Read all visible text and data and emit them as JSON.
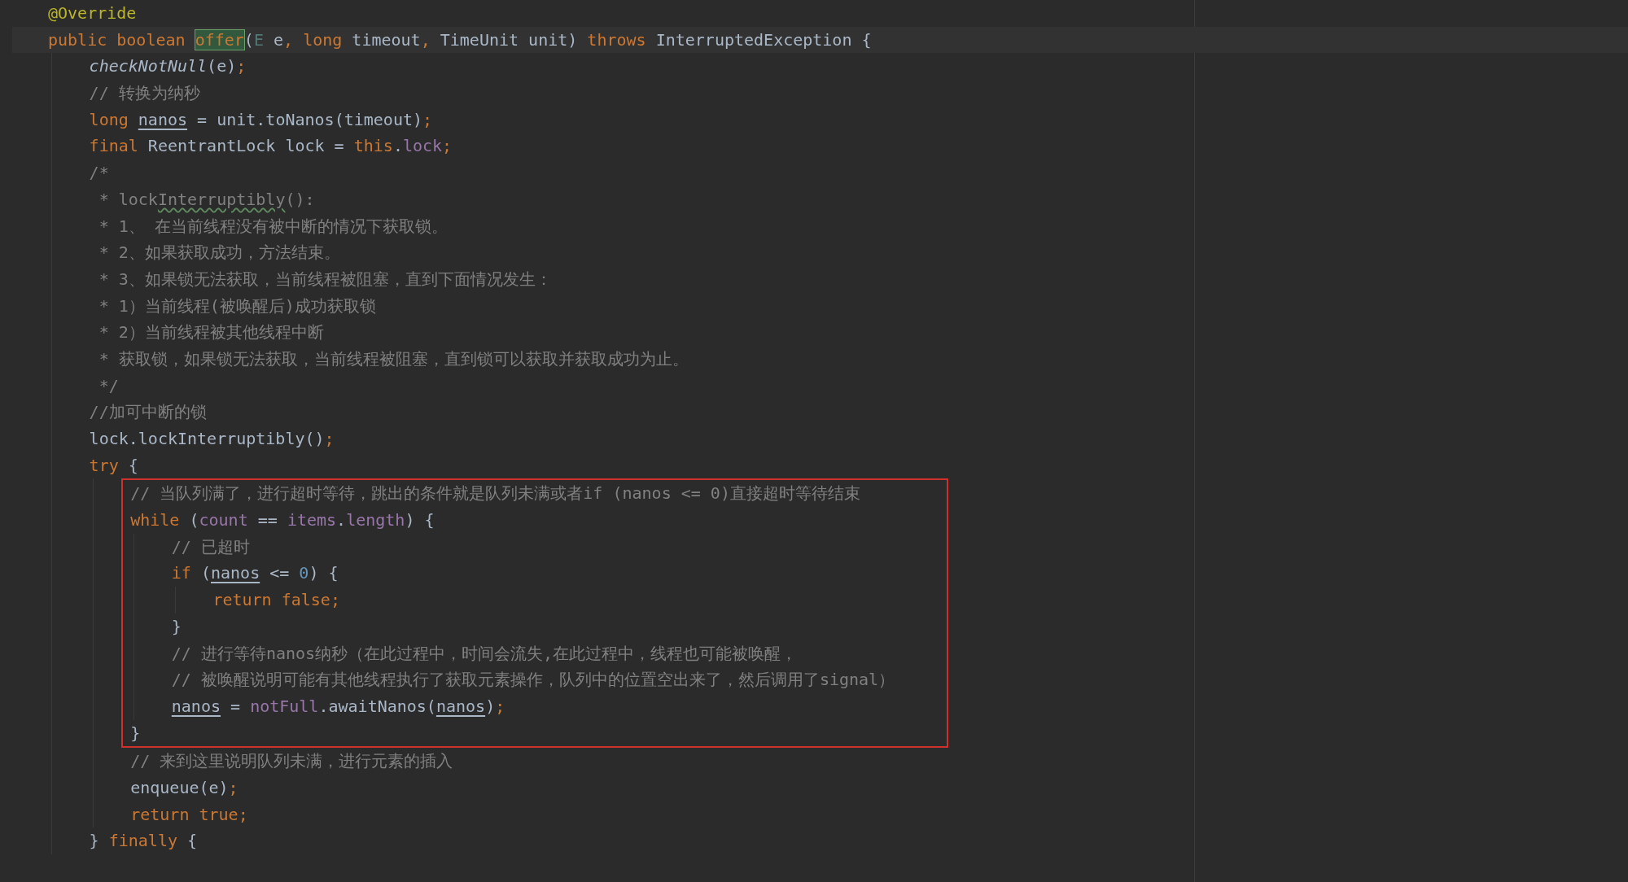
{
  "lines": [
    {
      "kind": "line",
      "tokens": [
        {
          "text": "@Override",
          "kind": "annot"
        }
      ]
    },
    {
      "kind": "line",
      "current": true,
      "tokens": [
        {
          "text": "public boolean ",
          "kind": "kw"
        },
        {
          "text": "offer",
          "kind": "match"
        },
        {
          "text": "(",
          "kind": "plain"
        },
        {
          "text": "E",
          "kind": "tparam"
        },
        {
          "text": " e",
          "kind": "plain"
        },
        {
          "text": ", ",
          "kind": "kw"
        },
        {
          "text": "long",
          "kind": "kw"
        },
        {
          "text": " timeout",
          "kind": "plain"
        },
        {
          "text": ", ",
          "kind": "kw"
        },
        {
          "text": "TimeUnit unit) ",
          "kind": "plain"
        },
        {
          "text": "throws",
          "kind": "kw"
        },
        {
          "text": " InterruptedException {",
          "kind": "plain"
        }
      ],
      "children": [
        {
          "kind": "line",
          "tokens": [
            {
              "text": "checkNotNull",
              "kind": "italic"
            },
            {
              "text": "(e)",
              "kind": "plain"
            },
            {
              "text": ";",
              "kind": "kw"
            }
          ]
        },
        {
          "kind": "line",
          "tokens": [
            {
              "text": "// 转换为纳秒",
              "kind": "comment"
            }
          ]
        },
        {
          "kind": "line",
          "tokens": [
            {
              "text": "long ",
              "kind": "kw"
            },
            {
              "text": "nanos",
              "kind": "var"
            },
            {
              "text": " = unit.toNanos(timeout)",
              "kind": "plain"
            },
            {
              "text": ";",
              "kind": "kw"
            }
          ]
        },
        {
          "kind": "line",
          "tokens": [
            {
              "text": "final ",
              "kind": "kw"
            },
            {
              "text": "ReentrantLock lock = ",
              "kind": "plain"
            },
            {
              "text": "this",
              "kind": "kw"
            },
            {
              "text": ".",
              "kind": "plain"
            },
            {
              "text": "lock",
              "kind": "field"
            },
            {
              "text": ";",
              "kind": "kw"
            }
          ]
        },
        {
          "kind": "line",
          "tokens": [
            {
              "text": "/*",
              "kind": "comment"
            }
          ]
        },
        {
          "kind": "line",
          "tokens": [
            {
              "text": " * lock",
              "kind": "comment"
            },
            {
              "text": "Interruptibly",
              "kind": "typo"
            },
            {
              "text": "():",
              "kind": "comment"
            }
          ]
        },
        {
          "kind": "line",
          "tokens": [
            {
              "text": " * 1、 在当前线程没有被中断的情况下获取锁。",
              "kind": "comment"
            }
          ]
        },
        {
          "kind": "line",
          "tokens": [
            {
              "text": " * 2、如果获取成功，方法结束。",
              "kind": "comment"
            }
          ]
        },
        {
          "kind": "line",
          "tokens": [
            {
              "text": " * 3、如果锁无法获取，当前线程被阻塞，直到下面情况发生：",
              "kind": "comment"
            }
          ]
        },
        {
          "kind": "line",
          "tokens": [
            {
              "text": " * 1）当前线程(被唤醒后)成功获取锁",
              "kind": "comment"
            }
          ]
        },
        {
          "kind": "line",
          "tokens": [
            {
              "text": " * 2）当前线程被其他线程中断",
              "kind": "comment"
            }
          ]
        },
        {
          "kind": "line",
          "tokens": [
            {
              "text": " * 获取锁，如果锁无法获取，当前线程被阻塞，直到锁可以获取并获取成功为止。",
              "kind": "comment"
            }
          ]
        },
        {
          "kind": "line",
          "tokens": [
            {
              "text": " */",
              "kind": "comment"
            }
          ]
        },
        {
          "kind": "line",
          "tokens": [
            {
              "text": "//加可中断的锁",
              "kind": "comment"
            }
          ]
        },
        {
          "kind": "line",
          "tokens": [
            {
              "text": "lock.lockInterruptibly()",
              "kind": "plain"
            },
            {
              "text": ";",
              "kind": "kw"
            }
          ]
        },
        {
          "kind": "line",
          "tokens": [
            {
              "text": "try",
              "kind": "kw"
            },
            {
              "text": " {",
              "kind": "plain"
            }
          ],
          "children": [
            {
              "kind": "box",
              "children": [
                {
                  "kind": "line",
                  "tokens": [
                    {
                      "text": "// 当队列满了，进行超时等待，跳出的条件就是队列未满或者if (nanos <= 0)直接超时等待结束",
                      "kind": "comment"
                    }
                  ]
                },
                {
                  "kind": "line",
                  "tokens": [
                    {
                      "text": "while",
                      "kind": "kw"
                    },
                    {
                      "text": " (",
                      "kind": "plain"
                    },
                    {
                      "text": "count",
                      "kind": "field"
                    },
                    {
                      "text": " == ",
                      "kind": "plain"
                    },
                    {
                      "text": "items",
                      "kind": "field"
                    },
                    {
                      "text": ".",
                      "kind": "plain"
                    },
                    {
                      "text": "length",
                      "kind": "field"
                    },
                    {
                      "text": ") {",
                      "kind": "plain"
                    }
                  ],
                  "children": [
                    {
                      "kind": "line",
                      "tokens": [
                        {
                          "text": "// 已超时",
                          "kind": "comment"
                        }
                      ]
                    },
                    {
                      "kind": "line",
                      "tokens": [
                        {
                          "text": "if",
                          "kind": "kw"
                        },
                        {
                          "text": " (",
                          "kind": "plain"
                        },
                        {
                          "text": "nanos",
                          "kind": "var"
                        },
                        {
                          "text": " <= ",
                          "kind": "plain"
                        },
                        {
                          "text": "0",
                          "kind": "num"
                        },
                        {
                          "text": ") {",
                          "kind": "plain"
                        }
                      ],
                      "children": [
                        {
                          "kind": "line",
                          "tokens": [
                            {
                              "text": "return false",
                              "kind": "kw"
                            },
                            {
                              "text": ";",
                              "kind": "kw"
                            }
                          ]
                        }
                      ]
                    },
                    {
                      "kind": "line",
                      "tokens": [
                        {
                          "text": "}",
                          "kind": "plain"
                        }
                      ]
                    },
                    {
                      "kind": "line",
                      "tokens": [
                        {
                          "text": "// 进行等待nanos纳秒（在此过程中，时间会流失,在此过程中，线程也可能被唤醒，",
                          "kind": "comment"
                        }
                      ]
                    },
                    {
                      "kind": "line",
                      "tokens": [
                        {
                          "text": "// 被唤醒说明可能有其他线程执行了获取元素操作，队列中的位置空出来了，然后调用了signal）",
                          "kind": "comment"
                        }
                      ]
                    },
                    {
                      "kind": "line",
                      "tokens": [
                        {
                          "text": "nanos",
                          "kind": "var"
                        },
                        {
                          "text": " = ",
                          "kind": "plain"
                        },
                        {
                          "text": "notFull",
                          "kind": "field"
                        },
                        {
                          "text": ".awaitNanos(",
                          "kind": "plain"
                        },
                        {
                          "text": "nanos",
                          "kind": "var"
                        },
                        {
                          "text": ")",
                          "kind": "plain"
                        },
                        {
                          "text": ";",
                          "kind": "kw"
                        }
                      ]
                    }
                  ]
                },
                {
                  "kind": "line",
                  "tokens": [
                    {
                      "text": "}",
                      "kind": "plain"
                    }
                  ]
                }
              ]
            },
            {
              "kind": "line",
              "tokens": [
                {
                  "text": "// 来到这里说明队列未满，进行元素的插入",
                  "kind": "comment"
                }
              ]
            },
            {
              "kind": "line",
              "tokens": [
                {
                  "text": "enqueue(e)",
                  "kind": "plain"
                },
                {
                  "text": ";",
                  "kind": "kw"
                }
              ]
            },
            {
              "kind": "line",
              "tokens": [
                {
                  "text": "return true",
                  "kind": "kw"
                },
                {
                  "text": ";",
                  "kind": "kw"
                }
              ]
            }
          ]
        },
        {
          "kind": "line",
          "tokens": [
            {
              "text": "} ",
              "kind": "plain"
            },
            {
              "text": "finally",
              "kind": "kw"
            },
            {
              "text": " {",
              "kind": "plain"
            }
          ]
        }
      ]
    }
  ]
}
